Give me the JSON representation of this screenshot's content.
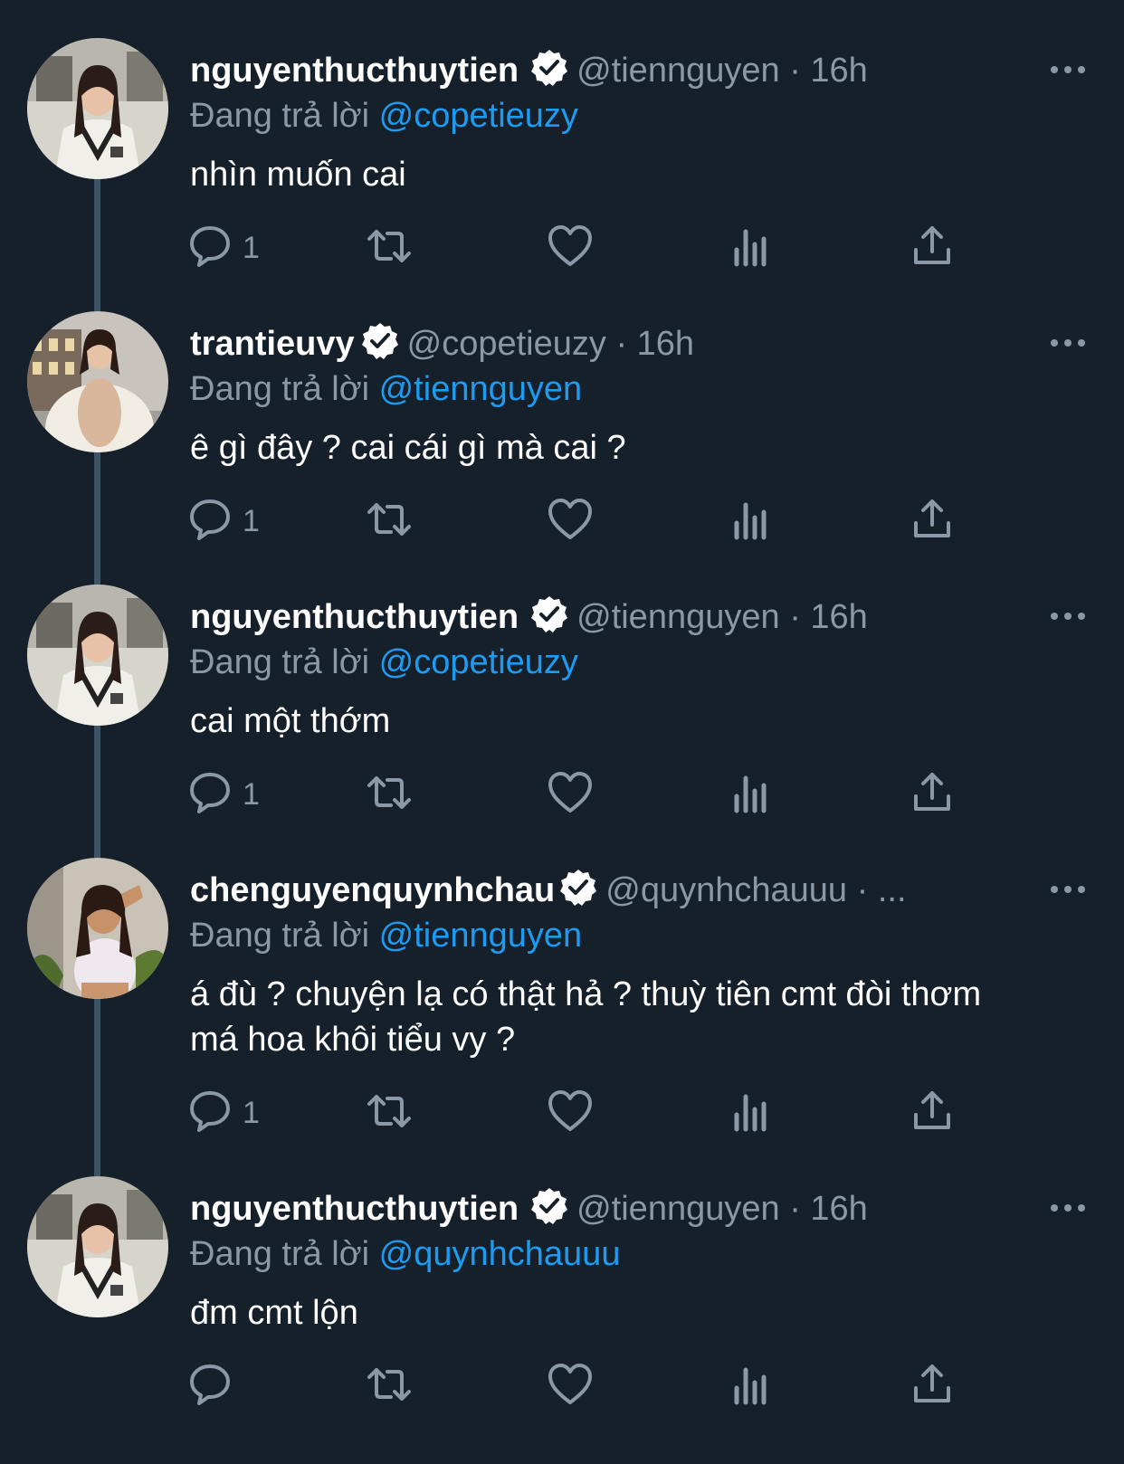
{
  "tweets": [
    {
      "name": "nguyenthucthuytien",
      "handle": "@tiennguyen",
      "separator": "·",
      "time": "16h",
      "reply_prefix": "Đang trả lời",
      "reply_to": "@copetieuzy",
      "text": "nhìn muốn cai",
      "reply_count": "1"
    },
    {
      "name": "trantieuvy",
      "handle": "@copetieuzy",
      "separator": "·",
      "time": "16h",
      "reply_prefix": "Đang trả lời",
      "reply_to": "@tiennguyen",
      "text": "ê gì đây ? cai cái gì mà cai ?",
      "reply_count": "1"
    },
    {
      "name": "nguyenthucthuytien",
      "handle": "@tiennguyen",
      "separator": "·",
      "time": "16h",
      "reply_prefix": "Đang trả lời",
      "reply_to": "@copetieuzy",
      "text": "cai một thớm",
      "reply_count": "1"
    },
    {
      "name": "chenguyenquynhchau",
      "handle": "@quynhchauuu",
      "separator": "·",
      "time": "...",
      "reply_prefix": "Đang trả lời",
      "reply_to": "@tiennguyen",
      "text": "á đù ? chuyện lạ có thật hả ? thuỳ tiên cmt đòi thơm má hoa khôi tiểu vy ?",
      "reply_count": "1"
    },
    {
      "name": "nguyenthucthuytien",
      "handle": "@tiennguyen",
      "separator": "·",
      "time": "16h",
      "reply_prefix": "Đang trả lời",
      "reply_to": "@quynhchauuu",
      "text": "đm cmt lộn",
      "reply_count": ""
    }
  ],
  "colors": {
    "background": "#15202b",
    "text": "#ffffff",
    "muted": "#8b98a5",
    "link": "#1d9bf0",
    "thread_line": "#3d5466"
  },
  "icons": [
    "verified-badge-icon",
    "more-icon",
    "reply-icon",
    "retweet-icon",
    "like-icon",
    "views-icon",
    "share-icon"
  ]
}
